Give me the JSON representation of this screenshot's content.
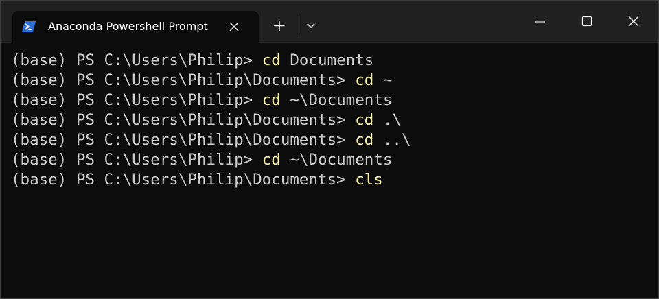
{
  "window": {
    "tab_title": "Anaconda Powershell Prompt"
  },
  "icons": {
    "tab": "powershell-icon",
    "tab_close": "close-icon",
    "new_tab": "plus-icon",
    "dropdown": "chevron-down-icon",
    "minimize": "minimize-icon",
    "maximize": "maximize-icon",
    "close": "close-icon"
  },
  "colors": {
    "background": "#0c0c0c",
    "titlebar": "#202020",
    "text": "#cccccc",
    "command": "#f9f1a5",
    "icon_blue": "#2d6fd6"
  },
  "terminal": {
    "lines": [
      {
        "prompt": "(base) PS C:\\Users\\Philip> ",
        "cmd": "cd",
        "args": " Documents"
      },
      {
        "prompt": "(base) PS C:\\Users\\Philip\\Documents> ",
        "cmd": "cd",
        "args": " ~"
      },
      {
        "prompt": "(base) PS C:\\Users\\Philip> ",
        "cmd": "cd",
        "args": " ~\\Documents"
      },
      {
        "prompt": "(base) PS C:\\Users\\Philip\\Documents> ",
        "cmd": "cd",
        "args": " .\\"
      },
      {
        "prompt": "(base) PS C:\\Users\\Philip\\Documents> ",
        "cmd": "cd",
        "args": " ..\\"
      },
      {
        "prompt": "(base) PS C:\\Users\\Philip> ",
        "cmd": "cd",
        "args": " ~\\Documents"
      },
      {
        "prompt": "(base) PS C:\\Users\\Philip\\Documents> ",
        "cmd": "cls",
        "args": ""
      }
    ]
  }
}
